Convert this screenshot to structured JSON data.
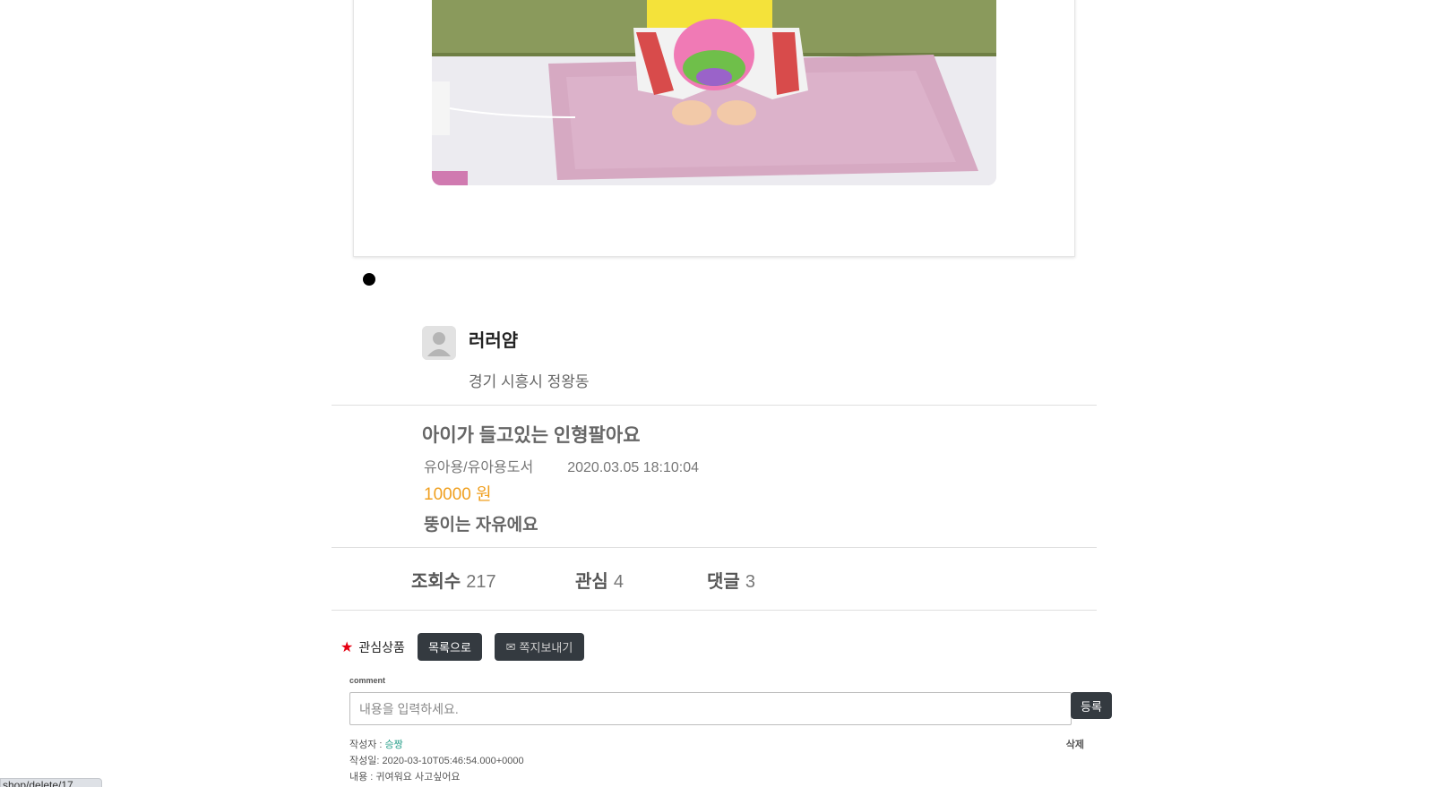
{
  "seller": {
    "name": "러러얌",
    "region": "경기 시흥시  정왕동"
  },
  "article": {
    "title": "아이가 들고있는 인형팔아요",
    "category": "유아용/유아용도서",
    "datetime": "2020.03.05 18:10:04",
    "price": "10000 원",
    "description": "뚱이는 자유에요"
  },
  "stats": {
    "views_label": "조회수",
    "views_value": "217",
    "interest_label": "관심",
    "interest_value": "4",
    "comments_label": "댓글",
    "comments_value": "3"
  },
  "actions": {
    "interest_label": "관심상품",
    "list_button": "목록으로",
    "message_button": "쪽지보내기"
  },
  "comment_form": {
    "label": "comment",
    "placeholder": "내용을 입력하세요.",
    "submit": "등록"
  },
  "comments": [
    {
      "author_label": "작성자 : ",
      "author": "승짱",
      "date_label": "작성일: ",
      "date": "2020-03-10T05:46:54.000+0000",
      "content_label": "내용 : ",
      "content": "귀여워요 사고싶어요",
      "delete_label": "삭제"
    }
  ],
  "status_bar": {
    "url": "shop/delete/17"
  },
  "colors": {
    "price": "#f0a020",
    "button_dark": "#343a40",
    "star": "#e60012",
    "comment_author": "#2ba08b"
  },
  "icons": [
    "user-avatar-icon",
    "star-icon",
    "mail-icon",
    "bullet-icon"
  ]
}
